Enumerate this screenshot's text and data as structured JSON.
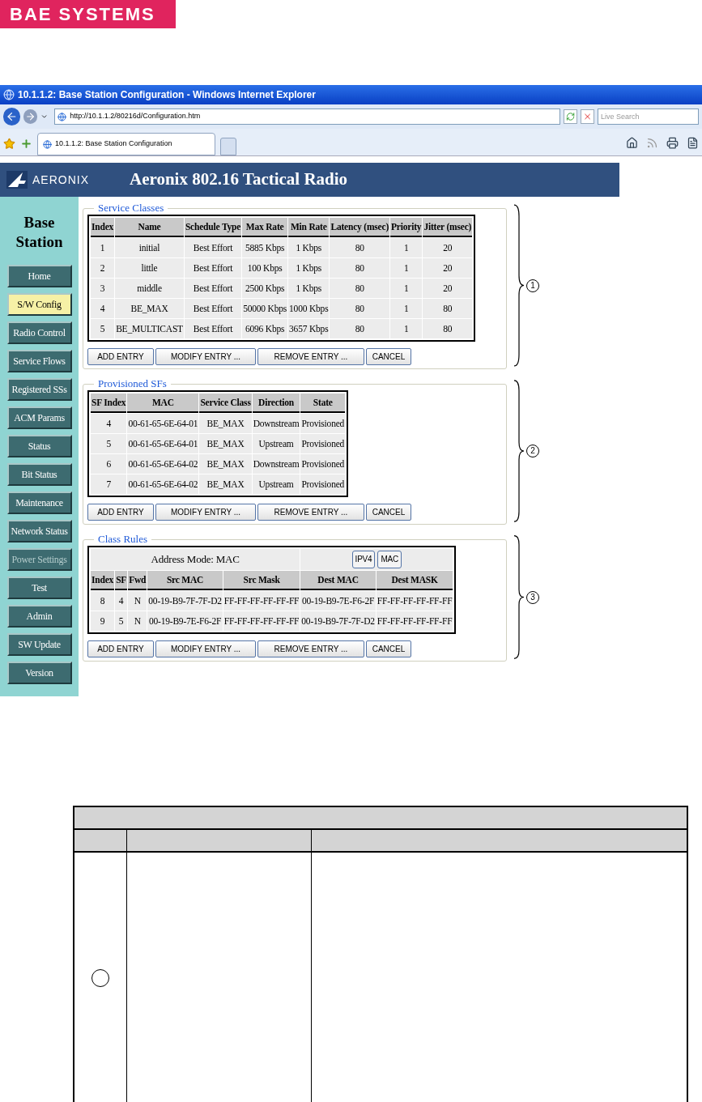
{
  "brand": {
    "logo": "BAE SYSTEMS"
  },
  "browser": {
    "title": "10.1.1.2: Base Station Configuration - Windows Internet Explorer",
    "address": "http://10.1.1.2/80216d/Configuration.htm",
    "search": {
      "placeholder": "Live Search"
    },
    "tabs": [
      {
        "label": "10.1.1.2: Base Station Configuration",
        "selected": true
      }
    ]
  },
  "app": {
    "logo": "AERONIX",
    "title": "Aeronix 802.16 Tactical Radio",
    "sidebar": {
      "title": "Base Station",
      "items": [
        {
          "label": "Home",
          "selected": false,
          "disabled": false
        },
        {
          "label": "S/W Config",
          "selected": true,
          "disabled": false
        },
        {
          "label": "Radio Control",
          "selected": false,
          "disabled": false
        },
        {
          "label": "Service Flows",
          "selected": false,
          "disabled": false
        },
        {
          "label": "Registered SSs",
          "selected": false,
          "disabled": false
        },
        {
          "label": "ACM Params",
          "selected": false,
          "disabled": false
        },
        {
          "label": "Status",
          "selected": false,
          "disabled": false
        },
        {
          "label": "Bit Status",
          "selected": false,
          "disabled": false
        },
        {
          "label": "Maintenance",
          "selected": false,
          "disabled": false
        },
        {
          "label": "Network Status",
          "selected": false,
          "disabled": false
        },
        {
          "label": "Power Settings",
          "selected": false,
          "disabled": true
        },
        {
          "label": "Test",
          "selected": false,
          "disabled": false
        },
        {
          "label": "Admin",
          "selected": false,
          "disabled": false
        },
        {
          "label": "SW Update",
          "selected": false,
          "disabled": false
        },
        {
          "label": "Version",
          "selected": false,
          "disabled": false
        }
      ]
    },
    "sections": [
      {
        "legend": "Service Classes",
        "callout": "1",
        "columns": [
          "Index",
          "Name",
          "Schedule Type",
          "Max Rate",
          "Min Rate",
          "Latency (msec)",
          "Priority",
          "Jitter (msec)"
        ],
        "rows": [
          [
            "1",
            "initial",
            "Best Effort",
            "5885 Kbps",
            "1 Kbps",
            "80",
            "1",
            "20"
          ],
          [
            "2",
            "little",
            "Best Effort",
            "100 Kbps",
            "1 Kbps",
            "80",
            "1",
            "20"
          ],
          [
            "3",
            "middle",
            "Best Effort",
            "2500 Kbps",
            "1 Kbps",
            "80",
            "1",
            "20"
          ],
          [
            "4",
            "BE_MAX",
            "Best Effort",
            "50000 Kbps",
            "1000 Kbps",
            "80",
            "1",
            "80"
          ],
          [
            "5",
            "BE_MULTICAST",
            "Best Effort",
            "6096 Kbps",
            "3657 Kbps",
            "80",
            "1",
            "80"
          ]
        ],
        "buttons": [
          "ADD ENTRY",
          "MODIFY ENTRY ...",
          "REMOVE ENTRY ...",
          "CANCEL"
        ]
      },
      {
        "legend": "Provisioned SFs",
        "callout": "2",
        "columns": [
          "SF Index",
          "MAC",
          "Service Class",
          "Direction",
          "State"
        ],
        "rows": [
          [
            "4",
            "00-61-65-6E-64-01",
            "BE_MAX",
            "Downstream",
            "Provisioned"
          ],
          [
            "5",
            "00-61-65-6E-64-01",
            "BE_MAX",
            "Upstream",
            "Provisioned"
          ],
          [
            "6",
            "00-61-65-6E-64-02",
            "BE_MAX",
            "Downstream",
            "Provisioned"
          ],
          [
            "7",
            "00-61-65-6E-64-02",
            "BE_MAX",
            "Upstream",
            "Provisioned"
          ]
        ],
        "buttons": [
          "ADD ENTRY",
          "MODIFY ENTRY ...",
          "REMOVE ENTRY ...",
          "CANCEL"
        ]
      },
      {
        "legend": "Class Rules",
        "callout": "3",
        "address_mode": "Address Mode: MAC",
        "mode_buttons": [
          "IPV4",
          "MAC"
        ],
        "columns": [
          "Index",
          "SF",
          "Fwd",
          "Src MAC",
          "Src Mask",
          "Dest MAC",
          "Dest MASK"
        ],
        "rows": [
          [
            "8",
            "4",
            "N",
            "00-19-B9-7F-7F-D2",
            "FF-FF-FF-FF-FF-FF",
            "00-19-B9-7E-F6-2F",
            "FF-FF-FF-FF-FF-FF"
          ],
          [
            "9",
            "5",
            "N",
            "00-19-B9-7E-F6-2F",
            "FF-FF-FF-FF-FF-FF",
            "00-19-B9-7F-7F-D2",
            "FF-FF-FF-FF-FF-FF"
          ]
        ],
        "buttons": [
          "ADD ENTRY",
          "MODIFY ENTRY ...",
          "REMOVE ENTRY ...",
          "CANCEL"
        ]
      }
    ]
  }
}
